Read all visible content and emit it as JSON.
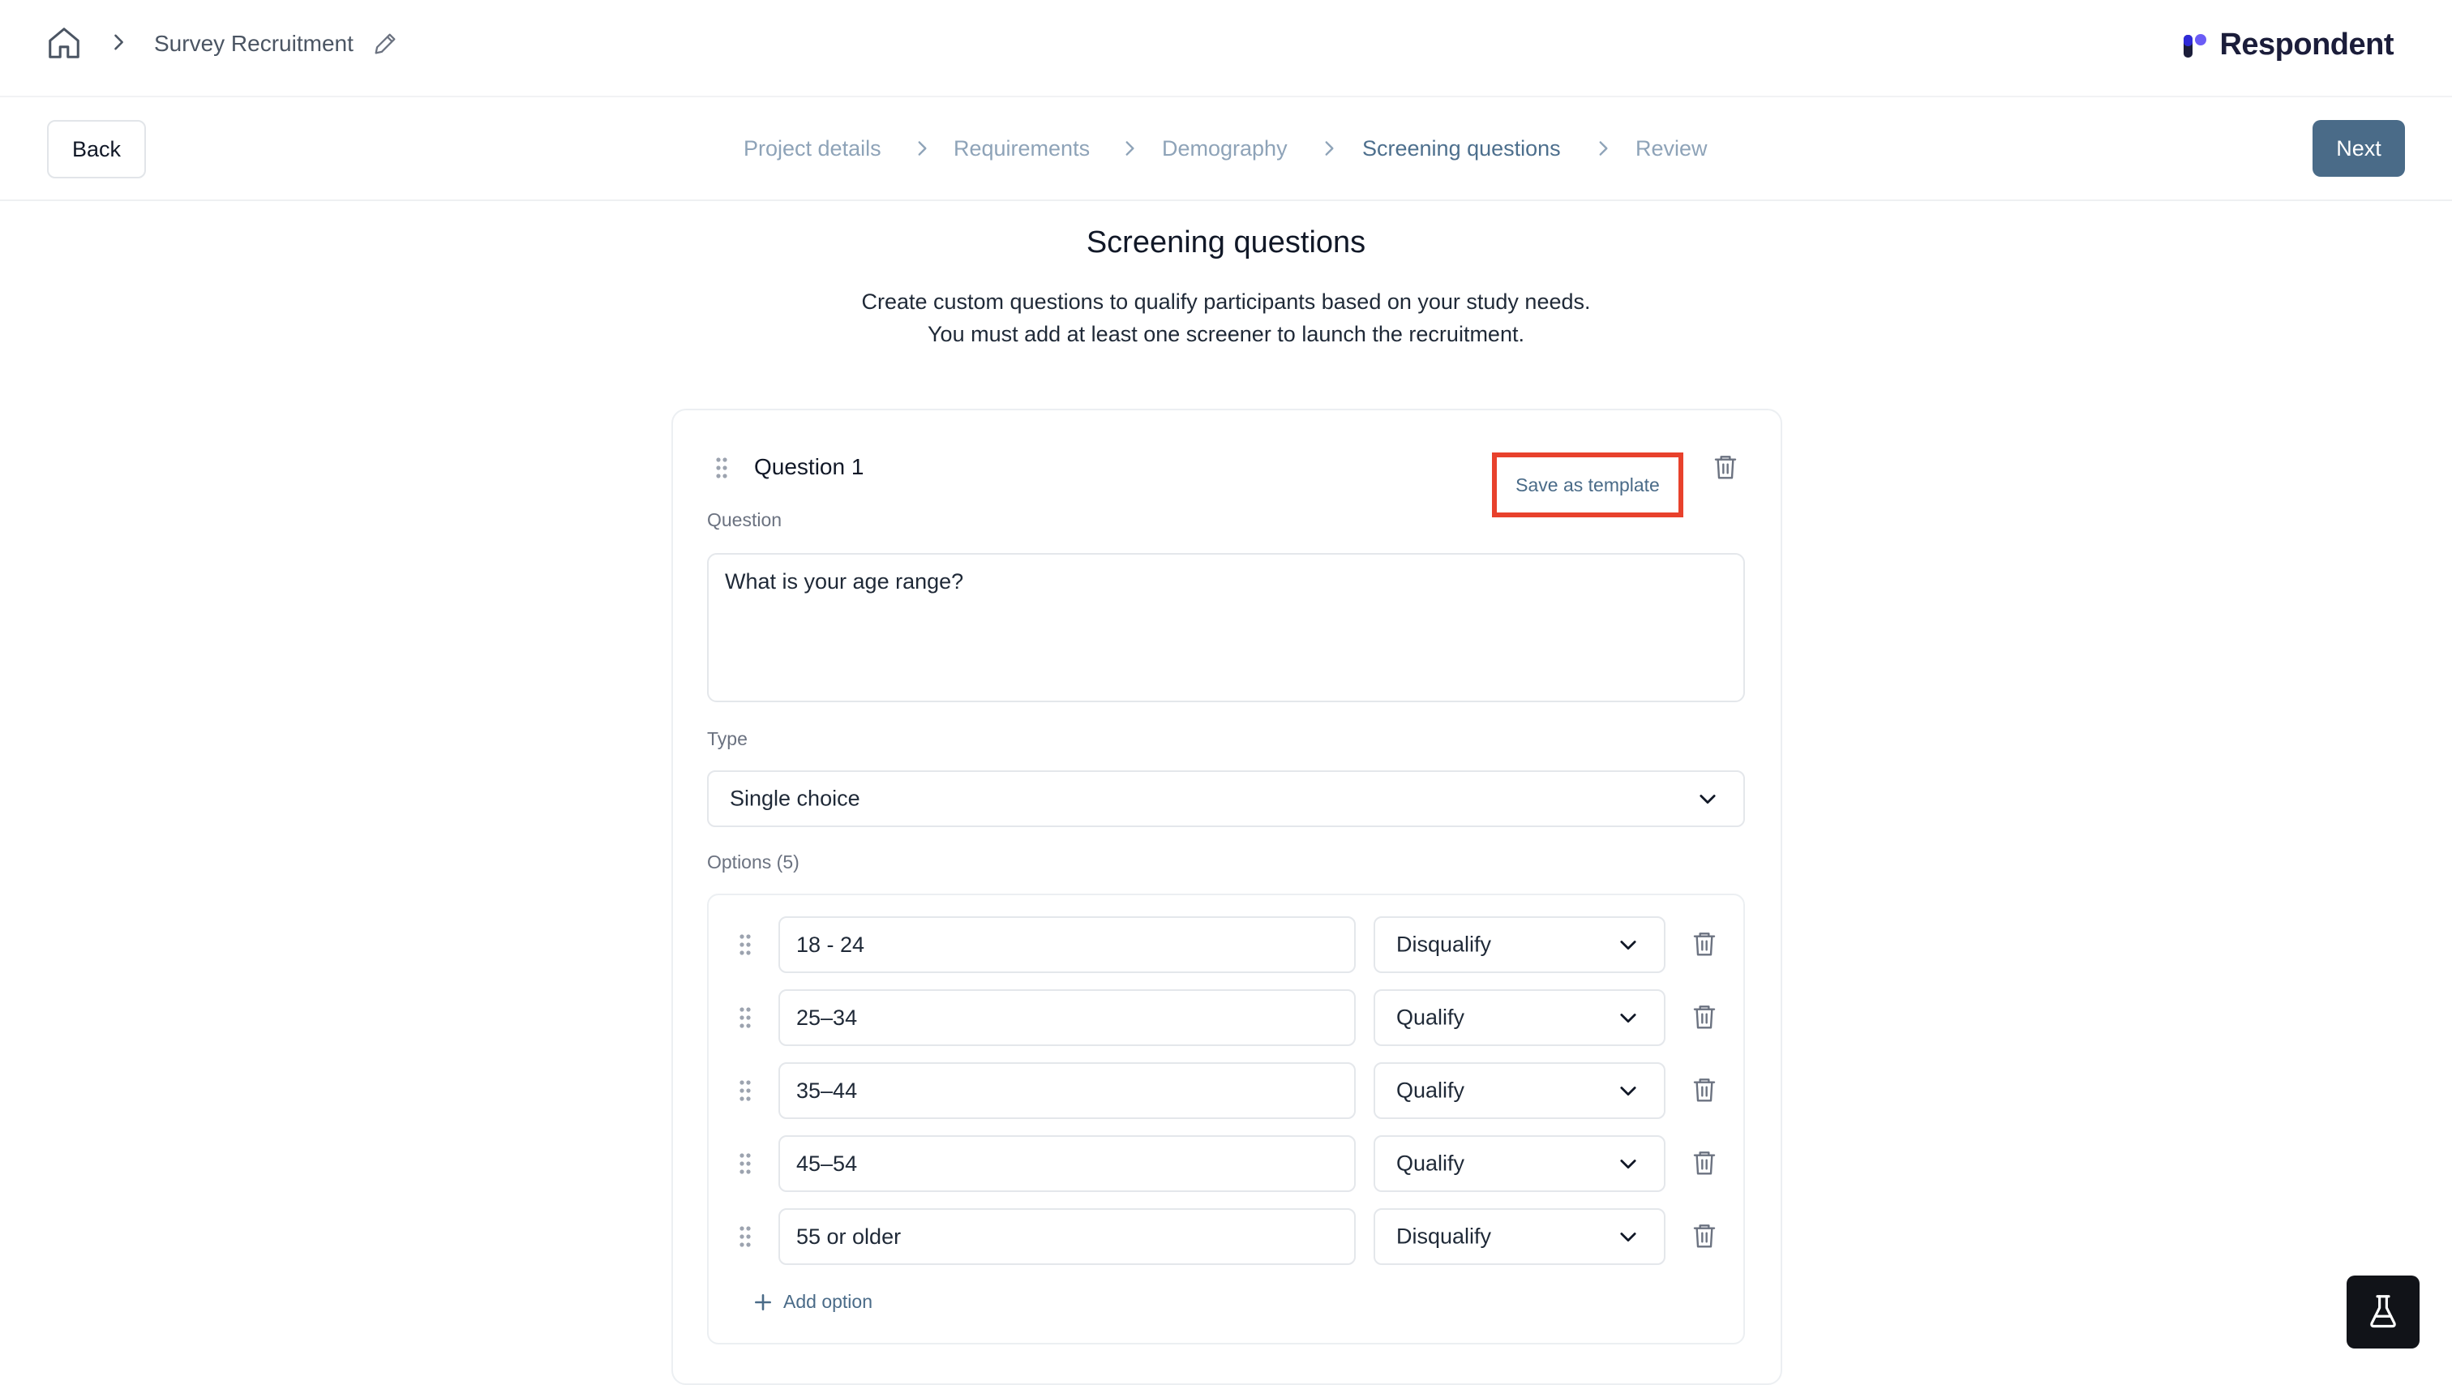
{
  "header": {
    "project_title": "Survey Recruitment",
    "brand_name": "Respondent",
    "brand_color": "#2f2ad8"
  },
  "stepbar": {
    "back_label": "Back",
    "next_label": "Next",
    "steps": [
      {
        "label": "Project details",
        "state": "done"
      },
      {
        "label": "Requirements",
        "state": "done"
      },
      {
        "label": "Demography",
        "state": "done"
      },
      {
        "label": "Screening questions",
        "state": "active"
      },
      {
        "label": "Review",
        "state": "upcoming"
      }
    ]
  },
  "page": {
    "title": "Screening questions",
    "description_line1": "Create custom questions to qualify participants based on your study needs.",
    "description_line2": "You must add at least one screener to launch the recruitment."
  },
  "question": {
    "title": "Question 1",
    "save_template_label": "Save as template",
    "question_label": "Question",
    "question_value": "What is your age range?",
    "type_label": "Type",
    "type_value": "Single choice",
    "options_label": "Options (5)",
    "options": [
      {
        "value": "18 - 24",
        "rule": "Disqualify"
      },
      {
        "value": "25–34",
        "rule": "Qualify"
      },
      {
        "value": "35–44",
        "rule": "Qualify"
      },
      {
        "value": "45–54",
        "rule": "Qualify"
      },
      {
        "value": "55 or older",
        "rule": "Disqualify"
      }
    ],
    "add_option_label": "Add option"
  },
  "icons": {
    "home": "home-icon",
    "breadcrumb_separator": "chevron-right-icon",
    "edit": "pencil-icon",
    "drag": "drag-handle-icon",
    "delete": "trash-icon",
    "dropdown": "chevron-down-icon",
    "add": "plus-icon",
    "help": "flask-icon"
  },
  "colors": {
    "accent": "#4a6b88",
    "step_inactive": "#8ea3b8",
    "highlight_box": "#e8412c"
  }
}
